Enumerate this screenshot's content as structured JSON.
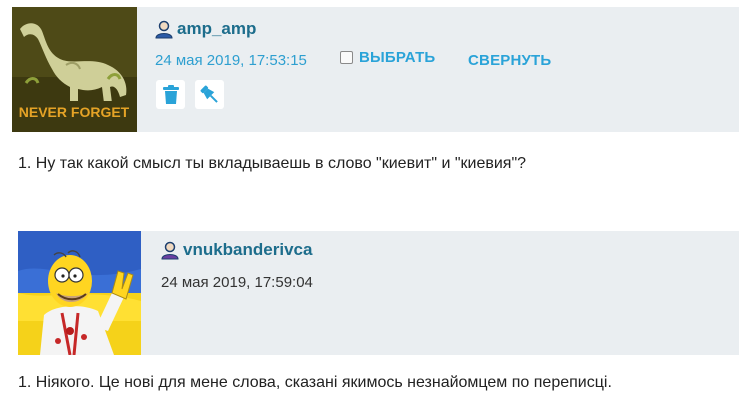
{
  "posts": [
    {
      "username": "amp_amp",
      "date": "24 мая 2019, 17:53:15",
      "actions": {
        "select_label": "ВЫБРАТЬ",
        "collapse_label": "СВЕРНУТЬ"
      },
      "avatar_caption": "NEVER FORGET",
      "text": "1. Ну так какой смысл ты вкладываешь в слово \"киевит\" и \"киевия\"?"
    },
    {
      "username": "vnukbanderivca",
      "date": "24 мая 2019, 17:59:04",
      "text": "1. Ніякого. Це нові для мене слова, сказані якимось незнайомцем по переписці."
    }
  ],
  "colors": {
    "header_bg": "#eaeef1",
    "username": "#1d6d8c",
    "accent": "#2aa3d8",
    "date_link": "#2e9fd0"
  },
  "icons": [
    "user-icon",
    "trash-icon",
    "pin-icon",
    "checkbox"
  ]
}
